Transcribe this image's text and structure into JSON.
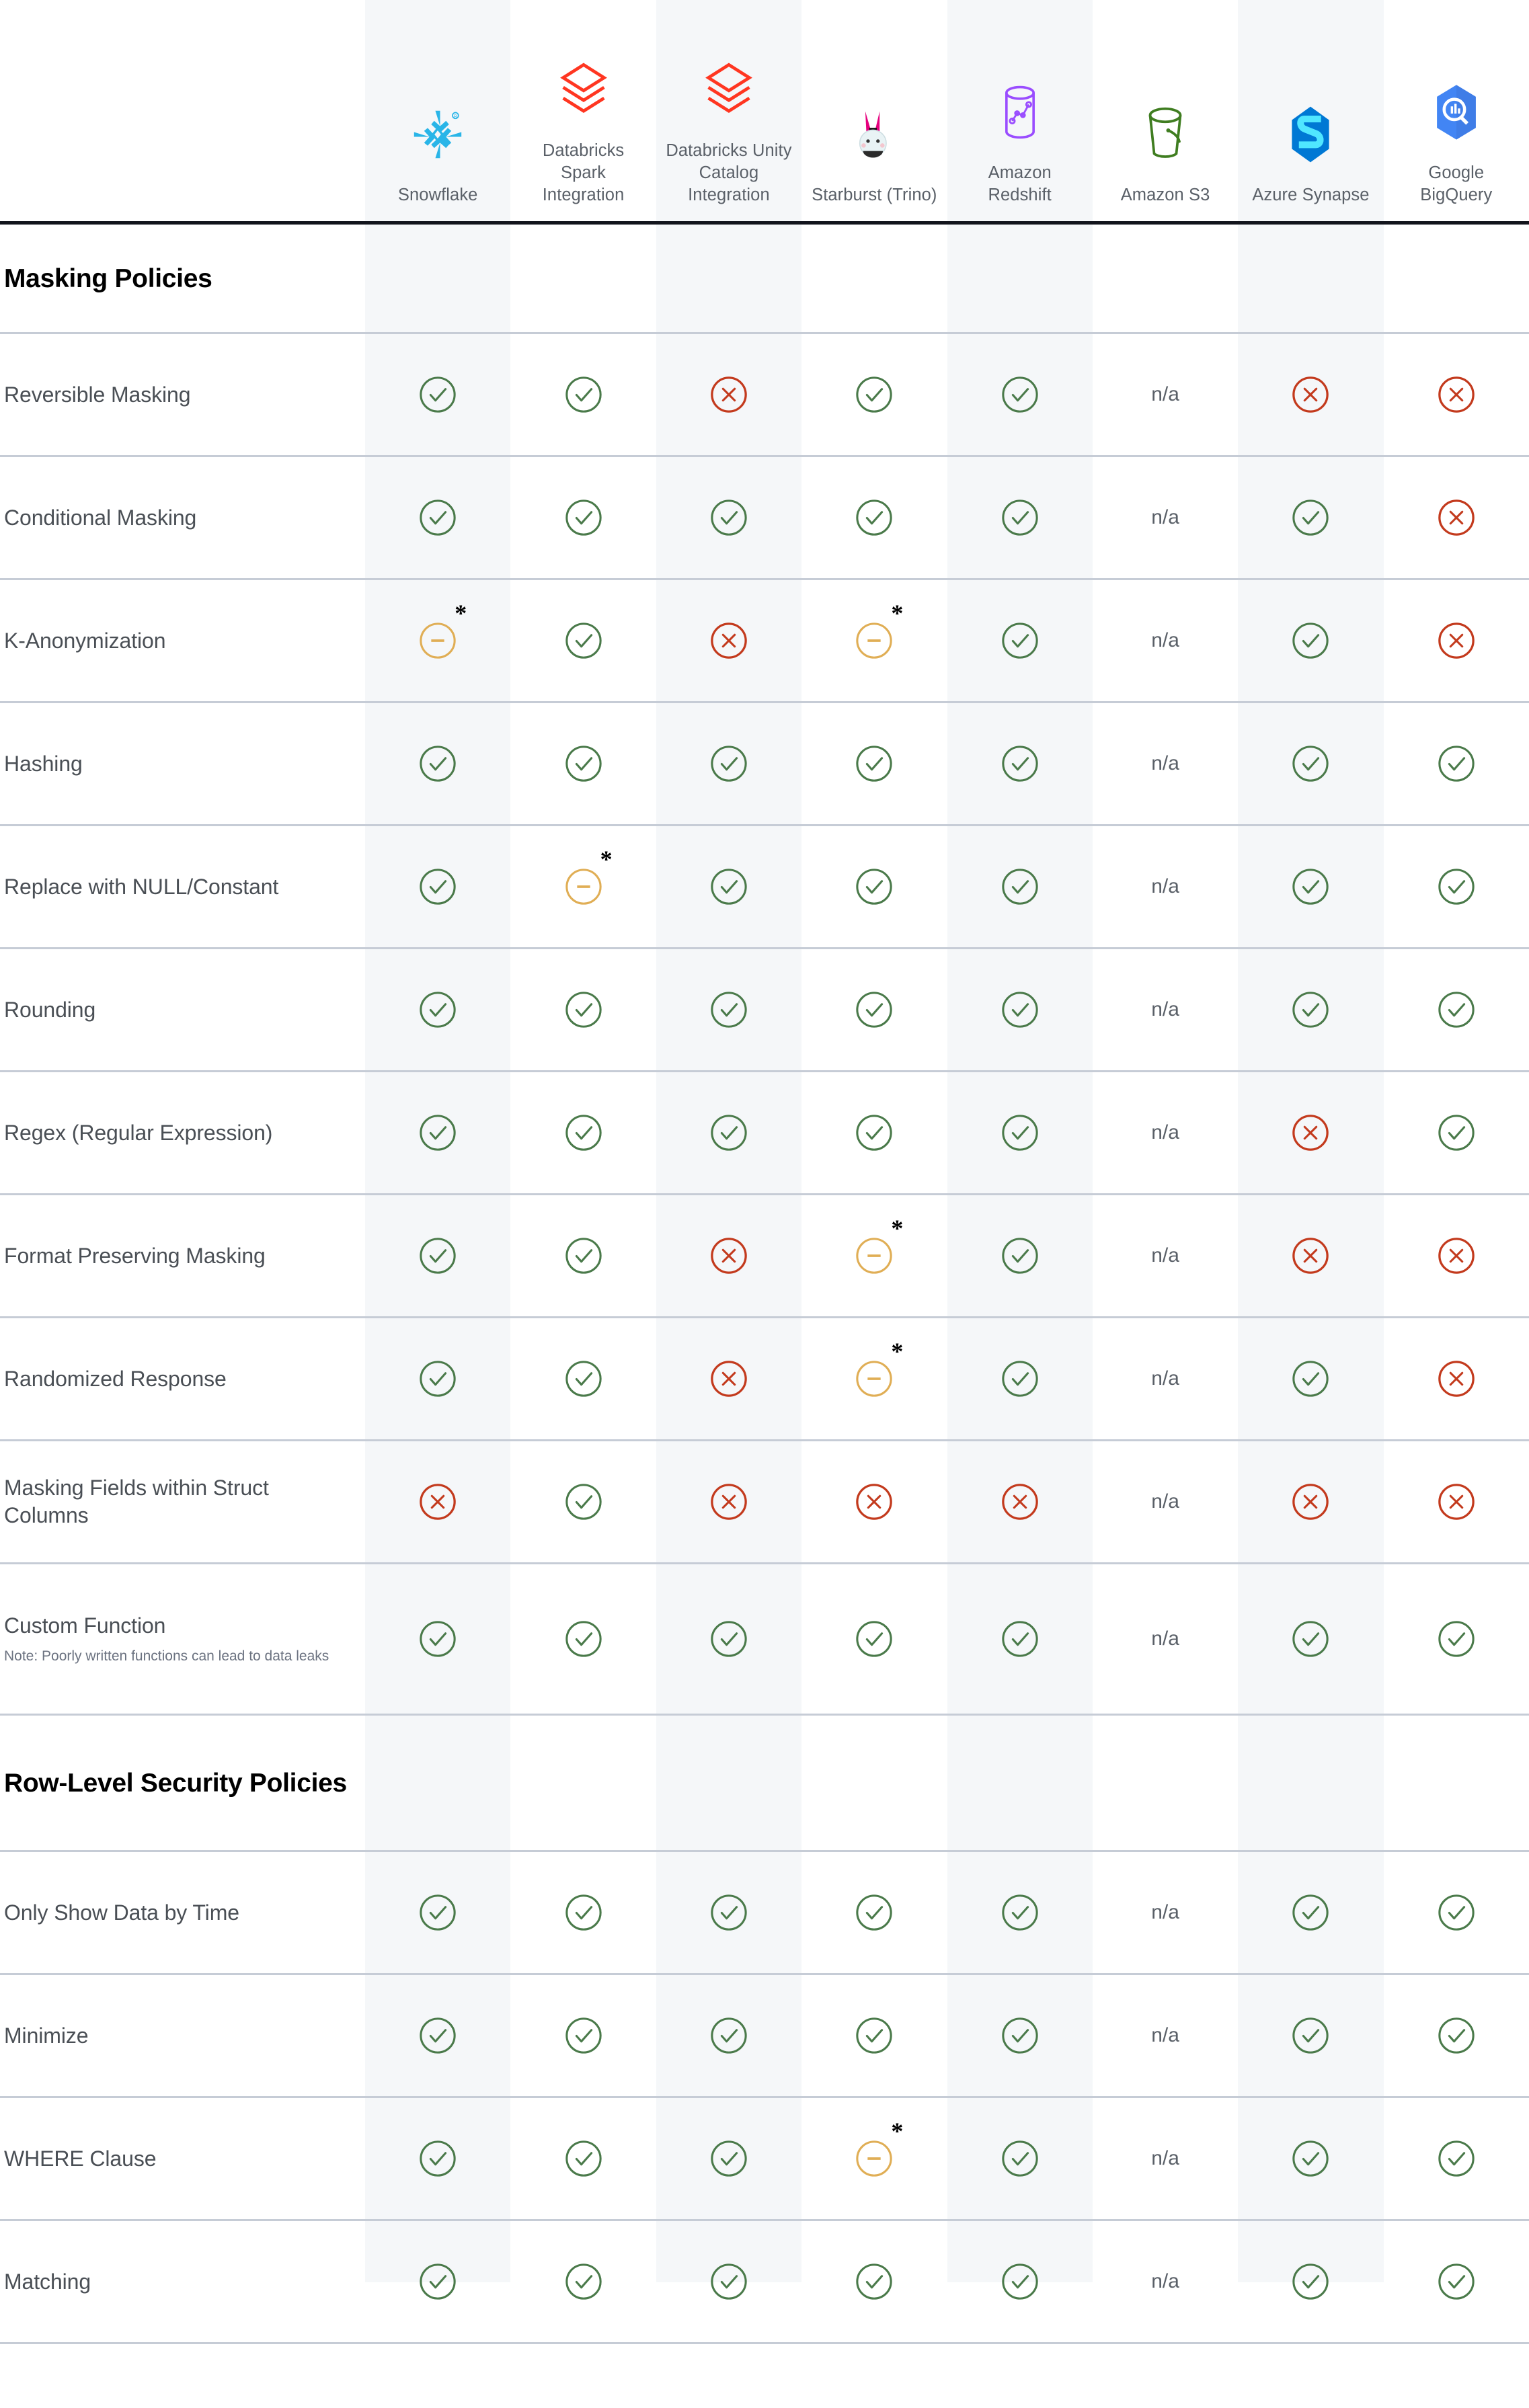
{
  "colors": {
    "yes": "#4a7a4a",
    "no": "#c33a1d",
    "partial": "#e0ae55",
    "stripe": "#f5f7f9",
    "divider": "#c6ccd6",
    "header_rule": "#12141c",
    "label_text": "#4a4f55",
    "section_text": "#000000",
    "note_text": "#6b7280"
  },
  "legend": {
    "na_text": "n/a",
    "asterisk": "*"
  },
  "columns": [
    {
      "name": "Snowflake",
      "logo": "snowflake-logo"
    },
    {
      "name": "Databricks Spark Integration",
      "logo": "databricks-logo"
    },
    {
      "name": "Databricks Unity Catalog Integration",
      "logo": "databricks-logo"
    },
    {
      "name": "Starburst (Trino)",
      "logo": "starburst-logo"
    },
    {
      "name": "Amazon Redshift",
      "logo": "amazon-redshift-logo"
    },
    {
      "name": "Amazon S3",
      "logo": "amazon-s3-logo"
    },
    {
      "name": "Azure Synapse",
      "logo": "azure-synapse-logo"
    },
    {
      "name": "Google BigQuery",
      "logo": "google-bigquery-logo"
    }
  ],
  "sections": [
    {
      "title": "Masking Policies",
      "rows": [
        {
          "label": "Reversible Masking",
          "values": [
            "yes",
            "yes",
            "no",
            "yes",
            "yes",
            "na",
            "no",
            "no"
          ]
        },
        {
          "label": "Conditional Masking",
          "values": [
            "yes",
            "yes",
            "yes",
            "yes",
            "yes",
            "na",
            "yes",
            "no"
          ]
        },
        {
          "label": "K-Anonymization",
          "values": [
            "partial*",
            "yes",
            "no",
            "partial*",
            "yes",
            "na",
            "yes",
            "no"
          ]
        },
        {
          "label": "Hashing",
          "values": [
            "yes",
            "yes",
            "yes",
            "yes",
            "yes",
            "na",
            "yes",
            "yes"
          ]
        },
        {
          "label": "Replace with NULL/Constant",
          "values": [
            "yes",
            "partial*",
            "yes",
            "yes",
            "yes",
            "na",
            "yes",
            "yes"
          ]
        },
        {
          "label": "Rounding",
          "values": [
            "yes",
            "yes",
            "yes",
            "yes",
            "yes",
            "na",
            "yes",
            "yes"
          ]
        },
        {
          "label": "Regex (Regular Expression)",
          "values": [
            "yes",
            "yes",
            "yes",
            "yes",
            "yes",
            "na",
            "no",
            "yes"
          ]
        },
        {
          "label": "Format Preserving Masking",
          "values": [
            "yes",
            "yes",
            "no",
            "partial*",
            "yes",
            "na",
            "no",
            "no"
          ]
        },
        {
          "label": "Randomized Response",
          "values": [
            "yes",
            "yes",
            "no",
            "partial*",
            "yes",
            "na",
            "yes",
            "no"
          ]
        },
        {
          "label": "Masking Fields within Struct Columns",
          "values": [
            "no",
            "yes",
            "no",
            "no",
            "no",
            "na",
            "no",
            "no"
          ]
        },
        {
          "label": "Custom Function",
          "note": "Note: Poorly written functions can lead to data leaks",
          "values": [
            "yes",
            "yes",
            "yes",
            "yes",
            "yes",
            "na",
            "yes",
            "yes"
          ]
        }
      ]
    },
    {
      "title": "Row-Level Security Policies",
      "rows": [
        {
          "label": "Only Show Data by Time",
          "values": [
            "yes",
            "yes",
            "yes",
            "yes",
            "yes",
            "na",
            "yes",
            "yes"
          ]
        },
        {
          "label": "Minimize",
          "values": [
            "yes",
            "yes",
            "yes",
            "yes",
            "yes",
            "na",
            "yes",
            "yes"
          ]
        },
        {
          "label": "WHERE Clause",
          "values": [
            "yes",
            "yes",
            "yes",
            "partial*",
            "yes",
            "na",
            "yes",
            "yes"
          ]
        },
        {
          "label": "Matching",
          "values": [
            "yes",
            "yes",
            "yes",
            "yes",
            "yes",
            "na",
            "yes",
            "yes"
          ]
        }
      ]
    }
  ]
}
